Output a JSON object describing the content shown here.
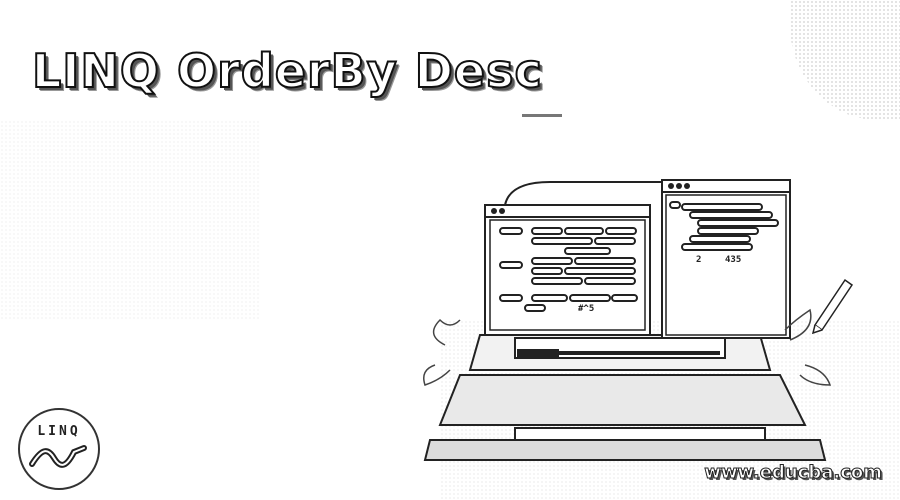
{
  "banner": {
    "title": "LINQ OrderBy Desc",
    "logo_text": "LINQ",
    "watermark": "www.educba.com"
  },
  "illustration": {
    "left_window_label": "#^5",
    "right_window_labels": [
      "2",
      "435"
    ]
  }
}
